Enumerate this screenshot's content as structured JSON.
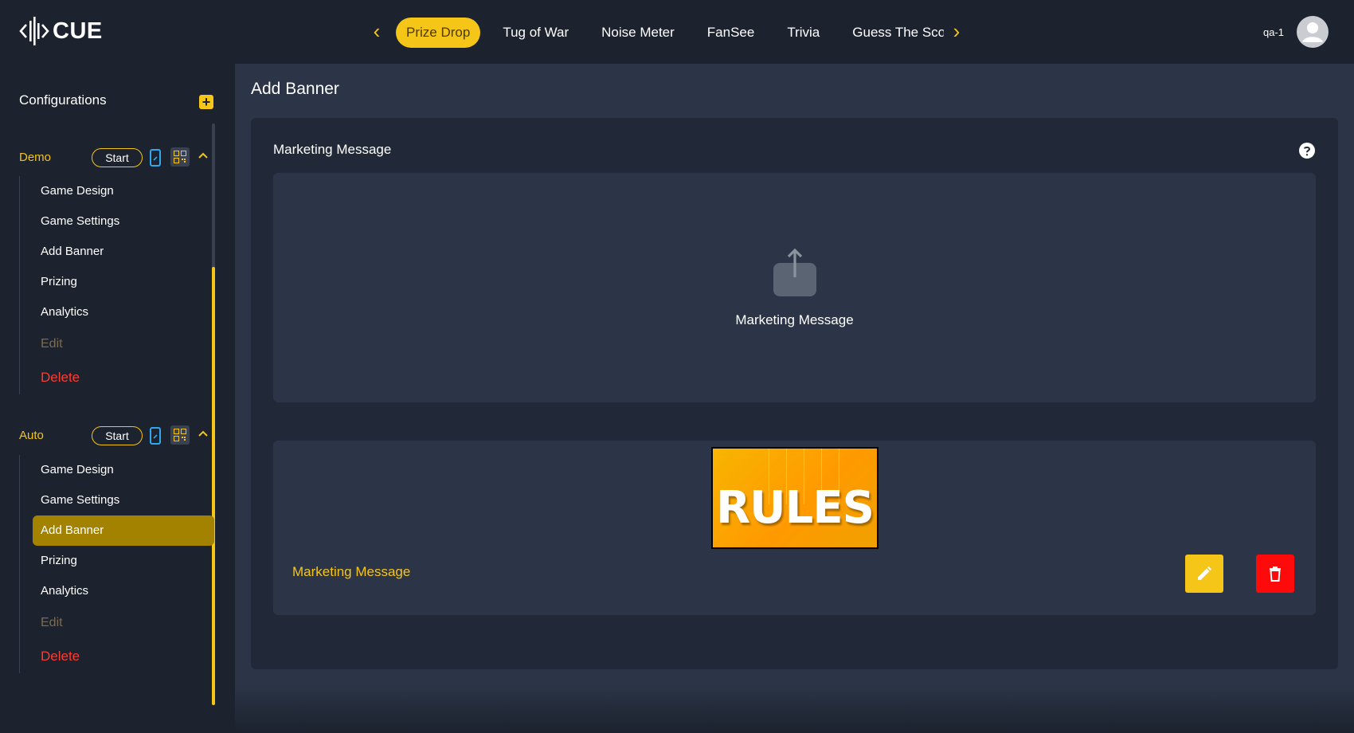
{
  "header": {
    "logo_text": "CUE",
    "tabs": [
      {
        "label": "Prize Drop",
        "active": true
      },
      {
        "label": "Tug of War"
      },
      {
        "label": "Noise Meter"
      },
      {
        "label": "FanSee"
      },
      {
        "label": "Trivia"
      },
      {
        "label": "Guess The Sco"
      }
    ],
    "user_name": "qa-1"
  },
  "sidebar": {
    "title": "Configurations",
    "groups": [
      {
        "name": "Demo",
        "start_label": "Start",
        "items": [
          "Game Design",
          "Game Settings",
          "Add Banner",
          "Prizing",
          "Analytics"
        ],
        "edit_label": "Edit",
        "delete_label": "Delete"
      },
      {
        "name": "Auto",
        "start_label": "Start",
        "items": [
          "Game Design",
          "Game Settings",
          "Add Banner",
          "Prizing",
          "Analytics"
        ],
        "active_item": "Add Banner",
        "edit_label": "Edit",
        "delete_label": "Delete"
      }
    ]
  },
  "main": {
    "page_title": "Add Banner",
    "section_label": "Marketing Message",
    "upload_label": "Marketing Message",
    "banner": {
      "image_text": "RULES",
      "name": "Marketing Message"
    }
  },
  "colors": {
    "accent": "#f5c518",
    "danger": "#ff0a0a",
    "background": "#1c222e",
    "panel": "#2b3547"
  }
}
